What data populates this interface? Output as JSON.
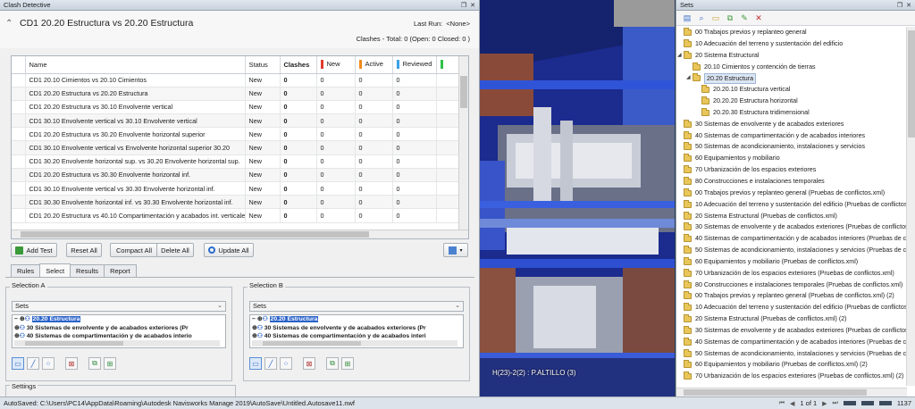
{
  "clash_panel": {
    "title": "Clash Detective",
    "test_name": "CD1 20.20 Estructura vs 20.20 Estructura",
    "last_run_label": "Last Run:",
    "last_run_value": "<None>",
    "summary": "Clashes -  Total:  0  (Open:  0  Closed:  0 )",
    "columns": [
      "Name",
      "Status",
      "Clashes",
      "New",
      "Active",
      "Reviewed",
      ""
    ],
    "status_colors": {
      "new": "#e03a2e",
      "active": "#f08a1c",
      "reviewed": "#3aa0e8",
      "approved": "#2ec14a"
    },
    "rows": [
      {
        "name": "CD1 20.10 Cimientos vs 20.10 Cimientos",
        "status": "New",
        "clashes": "0",
        "new": "0",
        "active": "0",
        "reviewed": "0"
      },
      {
        "name": "CD1 20.20 Estructura vs 20.20 Estructura",
        "status": "New",
        "clashes": "0",
        "new": "0",
        "active": "0",
        "reviewed": "0"
      },
      {
        "name": "CD1 20.20 Estructura vs 30.10 Envolvente vertical",
        "status": "New",
        "clashes": "0",
        "new": "0",
        "active": "0",
        "reviewed": "0"
      },
      {
        "name": "CD1 30.10 Envolvente vertical vs 30.10 Envolvente vertical",
        "status": "New",
        "clashes": "0",
        "new": "0",
        "active": "0",
        "reviewed": "0"
      },
      {
        "name": "CD1 20.20 Estructura vs 30.20 Envolvente horizontal superior",
        "status": "New",
        "clashes": "0",
        "new": "0",
        "active": "0",
        "reviewed": "0"
      },
      {
        "name": "CD1 30.10 Envolvente vertical vs Envolvente horizontal superior 30.20",
        "status": "New",
        "clashes": "0",
        "new": "0",
        "active": "0",
        "reviewed": "0"
      },
      {
        "name": "CD1 30.20 Envolvente horizontal sup. vs 30.20 Envolvente horizontal sup.",
        "status": "New",
        "clashes": "0",
        "new": "0",
        "active": "0",
        "reviewed": "0"
      },
      {
        "name": "CD1 20.20 Estructura vs 30.30 Envolvente horizontal inf.",
        "status": "New",
        "clashes": "0",
        "new": "0",
        "active": "0",
        "reviewed": "0"
      },
      {
        "name": "CD1 30.10 Envolvente vertical vs 30.30 Envolvente horizontal inf.",
        "status": "New",
        "clashes": "0",
        "new": "0",
        "active": "0",
        "reviewed": "0"
      },
      {
        "name": "CD1 30.30 Envolvente horizontal inf. vs 30.30 Envolvente horizontal inf.",
        "status": "New",
        "clashes": "0",
        "new": "0",
        "active": "0",
        "reviewed": "0"
      },
      {
        "name": "CD1 20.20 Estructura vs 40.10 Compartimentación y acabados int. verticales",
        "status": "New",
        "clashes": "0",
        "new": "0",
        "active": "0",
        "reviewed": "0"
      }
    ],
    "buttons": {
      "add_test": "Add Test",
      "reset_all": "Reset All",
      "compact_all": "Compact All",
      "delete_all": "Delete All",
      "update_all": "Update All"
    },
    "tabs": [
      "Rules",
      "Select",
      "Results",
      "Report"
    ],
    "active_tab": "Select",
    "selection_a": {
      "title": "Selection A",
      "dropdown": "Sets",
      "items": [
        "20.20 Estructura",
        "30 Sistemas de envolvente y de acabados exteriores (Pr",
        "40 Sistemas de compartimentación y de acabados interio"
      ]
    },
    "selection_b": {
      "title": "Selection B",
      "dropdown": "Sets",
      "items": [
        "20.20 Estructura",
        "30 Sistemas de envolvente y de acabados exteriores (Pr",
        "40 Sistemas de compartimentación y de acabados interi"
      ]
    },
    "settings_title": "Settings"
  },
  "viewport": {
    "label": "H(23)-2(2) : P.ALTILLO (3)"
  },
  "sets_panel": {
    "title": "Sets",
    "tree": [
      {
        "label": "00 Trabajos previos y replanteo general",
        "level": 0,
        "expander": ""
      },
      {
        "label": "10 Adecuación del terreno y sustentación del edificio",
        "level": 0,
        "expander": ""
      },
      {
        "label": "20 Sistema Estructural",
        "level": 0,
        "expander": "open"
      },
      {
        "label": "20.10 Cimientos y contención de tierras",
        "level": 1,
        "expander": ""
      },
      {
        "label": "20.20 Estructura",
        "level": 1,
        "expander": "open",
        "selected": true
      },
      {
        "label": "20.20.10 Estructura vertical",
        "level": 2,
        "expander": ""
      },
      {
        "label": "20.20.20 Estructura horizontal",
        "level": 2,
        "expander": ""
      },
      {
        "label": "20.20.30 Estructura  tridimensional",
        "level": 2,
        "expander": ""
      },
      {
        "label": "30 Sistemas de envolvente y de acabados exteriores",
        "level": 0,
        "expander": ""
      },
      {
        "label": "40 Sistemas de compartimentación y de acabados interiores",
        "level": 0,
        "expander": ""
      },
      {
        "label": "50 Sistemas de acondicionamiento, instalaciones y servicios",
        "level": 0,
        "expander": ""
      },
      {
        "label": "60 Equipamientos y mobiliario",
        "level": 0,
        "expander": ""
      },
      {
        "label": "70 Urbanización de los espacios exteriores",
        "level": 0,
        "expander": ""
      },
      {
        "label": "80 Construcciones e instalaciones temporales",
        "level": 0,
        "expander": ""
      },
      {
        "label": "00 Trabajos previos y replanteo general (Pruebas de conflictos.xml)",
        "level": 0,
        "expander": ""
      },
      {
        "label": "10 Adecuación del terreno y sustentación del edificio (Pruebas de conflictos.xml)",
        "level": 0,
        "expander": ""
      },
      {
        "label": "20 Sistema Estructural (Pruebas de conflictos.xml)",
        "level": 0,
        "expander": ""
      },
      {
        "label": "30 Sistemas de envolvente y de acabados exteriores (Pruebas de conflictos.xml)",
        "level": 0,
        "expander": ""
      },
      {
        "label": "40 Sistemas de compartimentación y de acabados interiores (Pruebas de conflictos.xml)",
        "level": 0,
        "expander": ""
      },
      {
        "label": "50 Sistemas de acondicionamiento, instalaciones y servicios (Pruebas de conflictos.xml)",
        "level": 0,
        "expander": ""
      },
      {
        "label": "60 Equipamientos y mobiliario (Pruebas de conflictos.xml)",
        "level": 0,
        "expander": ""
      },
      {
        "label": "70 Urbanización de los espacios exteriores (Pruebas de conflictos.xml)",
        "level": 0,
        "expander": ""
      },
      {
        "label": "80 Construcciones e instalaciones temporales (Pruebas de conflictos.xml)",
        "level": 0,
        "expander": ""
      },
      {
        "label": "00 Trabajos previos y replanteo general (Pruebas de conflictos.xml) (2)",
        "level": 0,
        "expander": ""
      },
      {
        "label": "10 Adecuación del terreno y sustentación del edificio (Pruebas de conflictos.xml)",
        "level": 0,
        "expander": ""
      },
      {
        "label": "20 Sistema Estructural (Pruebas de conflictos.xml) (2)",
        "level": 0,
        "expander": ""
      },
      {
        "label": "30 Sistemas de envolvente y de acabados exteriores (Pruebas de conflictos.xml)",
        "level": 0,
        "expander": ""
      },
      {
        "label": "40 Sistemas de compartimentación y de acabados interiores (Pruebas de conflictos.xml)",
        "level": 0,
        "expander": ""
      },
      {
        "label": "50 Sistemas de acondicionamiento, instalaciones y servicios (Pruebas de conflictos.xml)",
        "level": 0,
        "expander": ""
      },
      {
        "label": "60 Equipamientos y mobiliario (Pruebas de conflictos.xml) (2)",
        "level": 0,
        "expander": ""
      },
      {
        "label": "70 Urbanización de los espacios exteriores (Pruebas de conflictos.xml) (2)",
        "level": 0,
        "expander": ""
      }
    ]
  },
  "status_bar": {
    "message": "AutoSaved: C:\\Users\\PC14\\AppData\\Roaming\\Autodesk Navisworks Manage 2019\\AutoSave\\Untitled.Autosave11.nwf",
    "page": "1 of 1",
    "memory": "1137"
  }
}
